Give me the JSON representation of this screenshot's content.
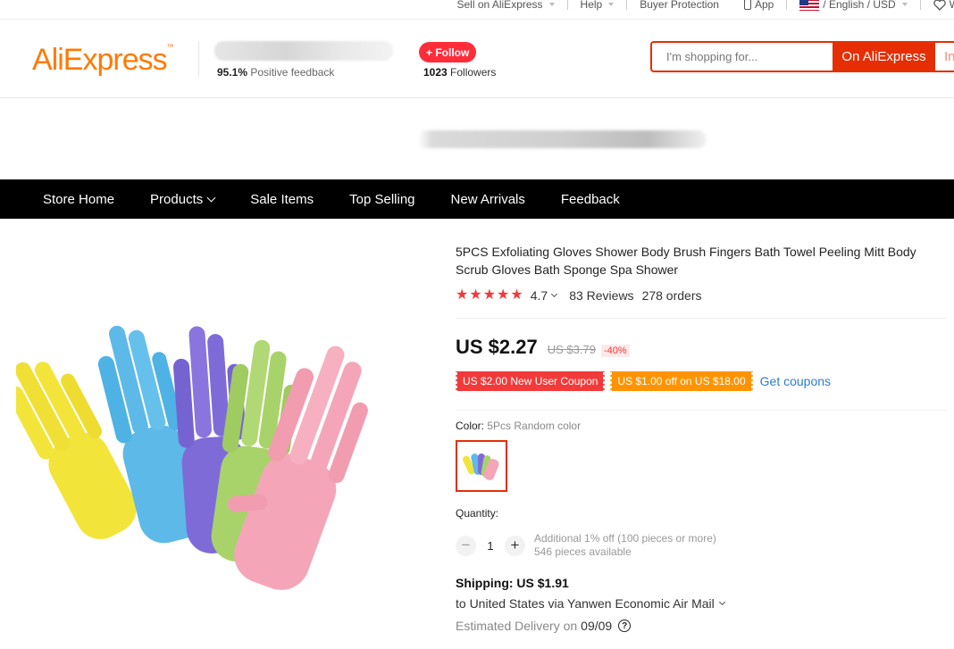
{
  "topbar": {
    "sell": "Sell on AliExpress",
    "help": "Help",
    "buyer_protection": "Buyer Protection",
    "app": "App",
    "lang": "/ English / USD",
    "wish": "W"
  },
  "header": {
    "logo_text": "AliExpress",
    "positive_pct": "95.1%",
    "positive_label": "Positive feedback",
    "follow_label": "+ Follow",
    "followers_count": "1023",
    "followers_label": "Followers",
    "search_placeholder": "I'm shopping for...",
    "search_btn": "On AliExpress",
    "search_btn2": "In"
  },
  "nav": {
    "items": [
      "Store Home",
      "Products",
      "Sale Items",
      "Top Selling",
      "New Arrivals",
      "Feedback"
    ]
  },
  "product": {
    "title": "5PCS Exfoliating Gloves Shower Body Brush Fingers Bath Towel Peeling Mitt Body Scrub Gloves Bath Sponge Spa Shower",
    "rating": "4.7",
    "reviews": "83 Reviews",
    "orders": "278 orders",
    "price": "US $2.27",
    "old_price": "US $3.79",
    "discount": "-40%",
    "coupon1": "US $2.00 New User Coupon",
    "coupon2": "US $1.00 off on US $18.00",
    "get_coupons": "Get coupons",
    "color_label": "Color:",
    "color_value": "5Pcs Random color",
    "quantity_label": "Quantity:",
    "quantity_value": "1",
    "qty_minus": "−",
    "qty_plus": "+",
    "qty_note1": "Additional 1% off (100 pieces or more)",
    "qty_note2": "546 pieces available",
    "shipping": "Shipping: US $1.91",
    "shipping_to": "to United States via Yanwen Economic Air Mail",
    "delivery_label": "Estimated Delivery on",
    "delivery_date": "09/09",
    "help_mark": "?"
  },
  "colors": {
    "accent": "#e62e04",
    "star": "#f23a3a",
    "coupon_red": "#f23a3a",
    "coupon_orange": "#ff9400",
    "link": "#2e7bcf"
  }
}
